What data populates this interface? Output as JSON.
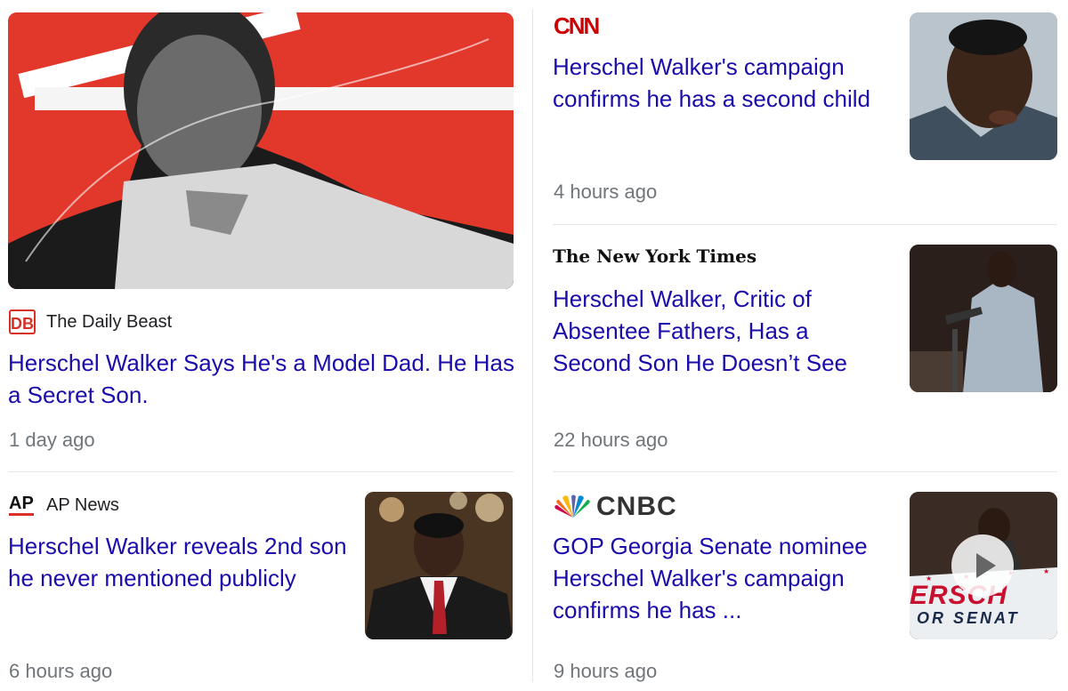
{
  "stories": [
    {
      "source": "The Daily Beast",
      "logo_text": "DB",
      "headline": "Herschel Walker Says He's a Model Dad. He Has a Secret Son.",
      "time": "1 day ago"
    },
    {
      "source": "AP News",
      "logo_text": "AP",
      "headline": "Herschel Walker reveals 2nd son he never mentioned publicly",
      "time": "6 hours ago"
    },
    {
      "source": "CNN",
      "logo_text": "CNN",
      "headline": "Herschel Walker's campaign confirms he has a second child",
      "time": "4 hours ago"
    },
    {
      "source": "The New York Times",
      "logo_text": "The New York Times",
      "headline": "Herschel Walker, Critic of Absentee Fathers, Has a Second Son He Doesn’t See",
      "time": "22 hours ago"
    },
    {
      "source": "CNBC",
      "logo_text": "CNBC",
      "headline": "GOP Georgia Senate nominee Herschel Walker's campaign confirms he has ...",
      "time": "9 hours ago",
      "video_banner_text": [
        "ERSCH",
        "OR SENAT"
      ]
    }
  ],
  "colors": {
    "headline": "#1a0dab",
    "time": "#70757a",
    "db_red": "#d93025",
    "cnn_red": "#cc0000",
    "hero_bg": "#e2382c"
  }
}
